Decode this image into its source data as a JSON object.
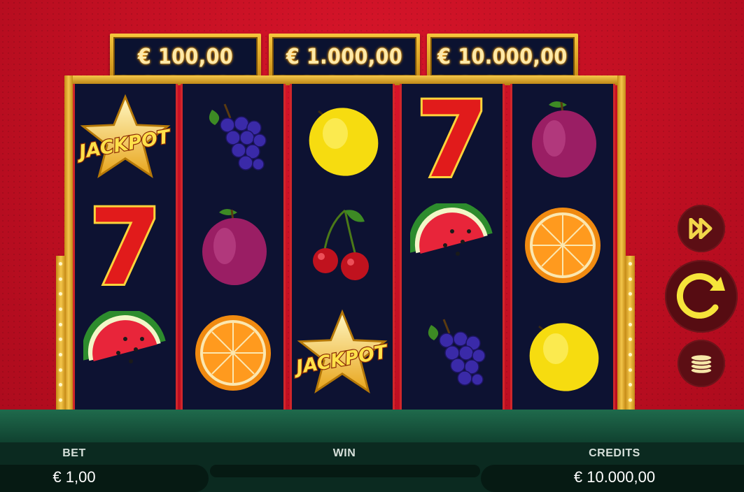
{
  "jackpots": [
    {
      "value": "€ 100,00"
    },
    {
      "value": "€ 1.000,00"
    },
    {
      "value": "€ 10.000,00"
    }
  ],
  "reels": [
    [
      "jackpot-star",
      "seven",
      "watermelon"
    ],
    [
      "grapes",
      "plum",
      "orange"
    ],
    [
      "lemon",
      "cherries",
      "jackpot-star"
    ],
    [
      "seven",
      "watermelon",
      "grapes"
    ],
    [
      "plum",
      "orange",
      "lemon"
    ]
  ],
  "symbol_text": {
    "jackpot": "JACKPOT",
    "seven": "7"
  },
  "footer": {
    "bet_label": "BET",
    "bet_value": "€ 1,00",
    "win_label": "WIN",
    "credits_label": "CREDITS",
    "credits_value": "€ 10.000,00"
  },
  "buttons": {
    "turbo_icon": "fast-forward-icon",
    "spin_icon": "spin-icon",
    "coins_icon": "coins-icon"
  },
  "colors": {
    "background": "#c00f22",
    "gold": "#f3c54a",
    "reel_bg": "#0d1232",
    "floor": "#1f6a4c",
    "button": "#5c0e14"
  }
}
